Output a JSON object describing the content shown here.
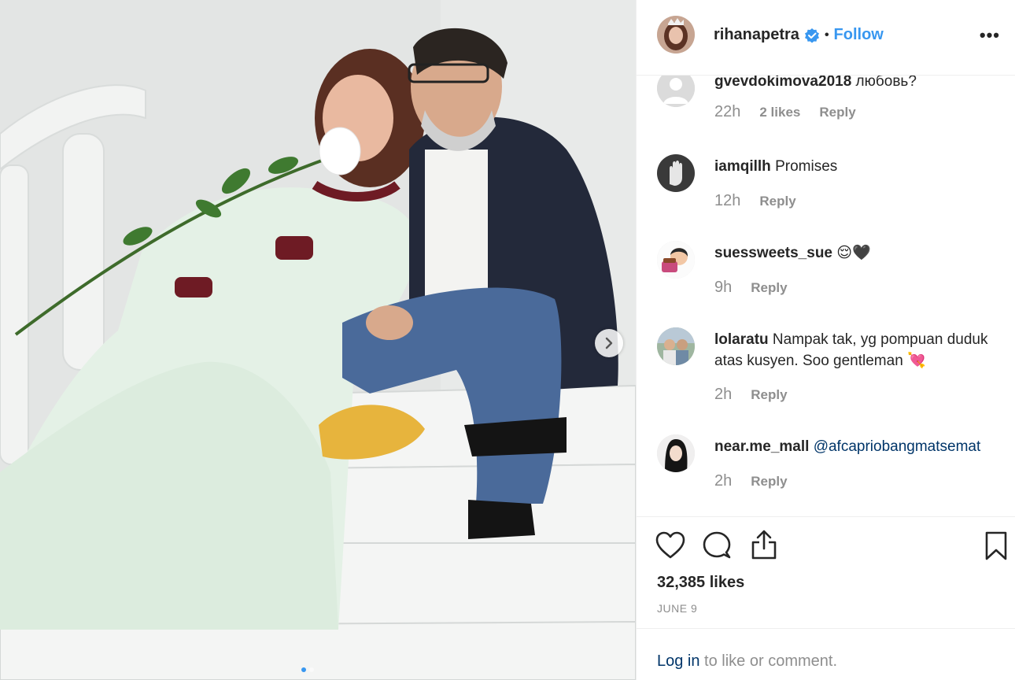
{
  "post": {
    "photo_alt": "",
    "carousel": {
      "count": 2,
      "active": 0
    }
  },
  "header": {
    "username": "rihanapetra",
    "separator": "•",
    "follow_label": "Follow",
    "more_label": "•••"
  },
  "comments": [
    {
      "username": "gvevdokimova2018",
      "text": "любовь?",
      "time": "22h",
      "likes": "2 likes",
      "reply": "Reply"
    },
    {
      "username": "iamqillh",
      "text": "Promises",
      "time": "12h",
      "likes": "",
      "reply": "Reply"
    },
    {
      "username": "suessweets_sue",
      "text": "😌🖤",
      "time": "9h",
      "likes": "",
      "reply": "Reply"
    },
    {
      "username": "lolaratu",
      "text": "Nampak tak, yg pompuan duduk atas kusyen. Soo gentleman 💘",
      "time": "2h",
      "likes": "",
      "reply": "Reply"
    },
    {
      "username": "near.me_mall",
      "text": "@afcapriobangmatsemat",
      "time": "2h",
      "likes": "",
      "reply": "Reply"
    }
  ],
  "actions": {
    "like_icon": "heart-icon",
    "comment_icon": "comment-icon",
    "share_icon": "share-icon",
    "save_icon": "bookmark-icon",
    "likes_count": "32,385 likes",
    "date": "JUNE 9"
  },
  "footer": {
    "login_label": "Log in",
    "login_suffix": " to like or comment."
  },
  "colors": {
    "accent": "#3897f0",
    "link_dark": "#003569",
    "muted": "#8e8e8e",
    "text": "#262626"
  }
}
